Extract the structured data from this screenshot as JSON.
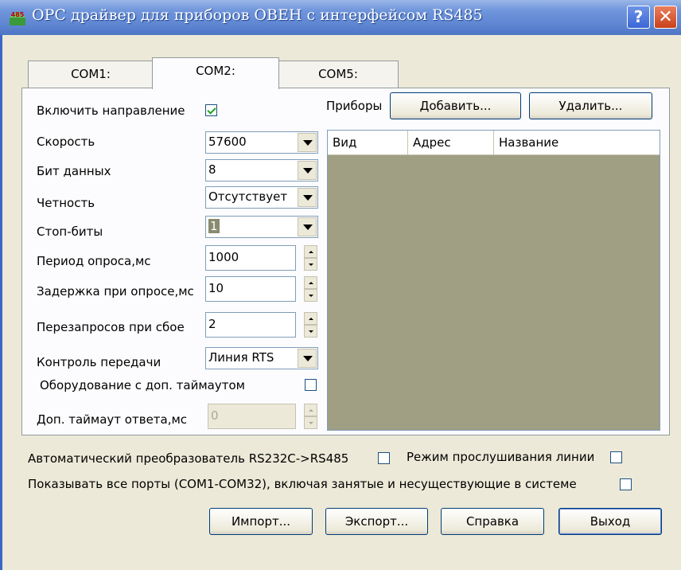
{
  "window": {
    "title": "OPC драйвер для приборов ОВЕН с интерфейсом RS485",
    "icon_text": "485",
    "help_label": "?",
    "close_label": "✕"
  },
  "tabs": [
    {
      "label": "COM1:",
      "active": false
    },
    {
      "label": "COM2:",
      "active": true
    },
    {
      "label": "COM5:",
      "active": false
    }
  ],
  "port": {
    "enable_direction_label": "Включить направление",
    "enable_direction_checked": true,
    "speed_label": "Скорость",
    "speed_value": "57600",
    "data_bits_label": "Бит данных",
    "data_bits_value": "8",
    "parity_label": "Четность",
    "parity_value": "Отсутствует",
    "stop_bits_label": "Стоп-биты",
    "stop_bits_value": "1",
    "poll_period_label": "Период опроса,мс",
    "poll_period_value": "1000",
    "poll_delay_label": "Задержка при опросе,мс",
    "poll_delay_value": "10",
    "retries_label": "Перезапросов при сбое",
    "retries_value": "2",
    "flow_control_label": "Контроль передачи",
    "flow_control_value": "Линия RTS",
    "extra_timeout_hw_label": "Оборудование с доп. таймаутом",
    "extra_timeout_hw_checked": false,
    "extra_timeout_label": "Доп. таймаут ответа,мс",
    "extra_timeout_value": "0"
  },
  "devices": {
    "label": "Приборы",
    "add_label": "Добавить...",
    "remove_label": "Удалить...",
    "columns": [
      "Вид",
      "Адрес",
      "Название"
    ]
  },
  "options": {
    "auto_converter_label": "Автоматический преобразователь RS232C->RS485",
    "auto_converter_checked": false,
    "listen_mode_label": "Режим прослушивания линии",
    "listen_mode_checked": false,
    "show_all_ports_label": "Показывать все порты (COM1-COM32), включая занятые и несуществующие в системе",
    "show_all_ports_checked": false
  },
  "buttons": {
    "import": "Импорт...",
    "export": "Экспорт...",
    "help": "Справка",
    "exit": "Выход"
  },
  "colors": {
    "titlebar": "#5f86d2",
    "list_background": "#a09e83"
  }
}
